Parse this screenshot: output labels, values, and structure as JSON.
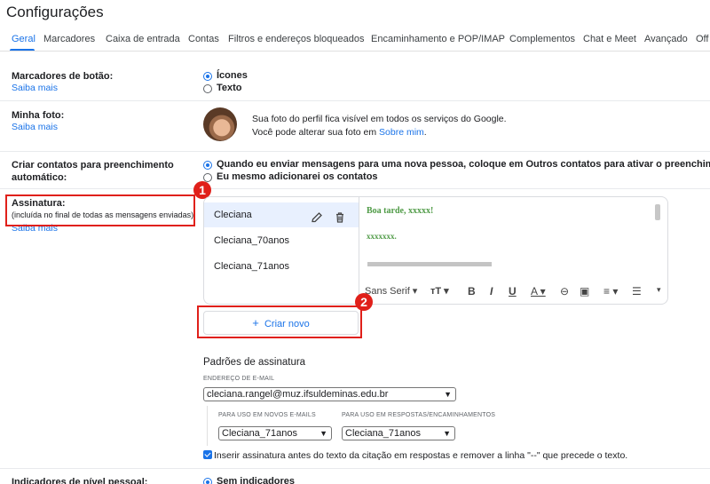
{
  "title": "Configurações",
  "tabs": [
    "Geral",
    "Marcadores",
    "Caixa de entrada",
    "Contas",
    "Filtros e endereços bloqueados",
    "Encaminhamento e POP/IMAP",
    "Complementos",
    "Chat e Meet",
    "Avançado",
    "Off"
  ],
  "active_tab": "Geral",
  "button_labels": {
    "label": "Marcadores de botão:",
    "learn_more": "Saiba mais",
    "options": [
      "Ícones",
      "Texto"
    ],
    "selected": "Ícones"
  },
  "photo": {
    "label": "Minha foto:",
    "learn_more": "Saiba mais",
    "line1": "Sua foto do perfil fica visível em todos os serviços do Google.",
    "line2_prefix": "Você pode alterar sua foto em ",
    "line2_link": "Sobre mim",
    "line2_suffix": "."
  },
  "autocomplete": {
    "label_line1": "Criar contatos para preenchimento",
    "label_line2": "automático:",
    "options": [
      "Quando eu enviar mensagens para uma nova pessoa, coloque em Outros contatos para ativar o preenchimento a",
      "Eu mesmo adicionarei os contatos"
    ],
    "selected_index": 0
  },
  "signature": {
    "label": "Assinatura:",
    "sublabel": "(incluída no final de todas as mensagens enviadas)",
    "learn_more": "Saiba mais",
    "items": [
      "Cleciana",
      "Cleciana_70anos",
      "Cleciana_71anos"
    ],
    "selected": "Cleciana",
    "editor_line1": "Boa tarde, xxxxx!",
    "editor_line2": "xxxxxxx.",
    "font_name": "Sans Serif",
    "create_button": "Criar novo"
  },
  "defaults": {
    "title": "Padrões de assinatura",
    "email_caption": "ENDEREÇO DE E-MAIL",
    "email_value": "cleciana.rangel@muz.ifsuldeminas.edu.br",
    "new_caption": "PARA USO EM NOVOS E-MAILS",
    "new_value": "Cleciana_71anos",
    "reply_caption": "PARA USO EM RESPOSTAS/ENCAMINHAMENTOS",
    "reply_value": "Cleciana_71anos",
    "insert_text": "Inserir assinatura antes do texto da citação em respostas e remover a linha \"--\" que precede o texto.",
    "insert_checked": true
  },
  "personal_indicators": {
    "label": "Indicadores de nível pessoal:",
    "option": "Sem indicadores"
  },
  "annotations": {
    "badge1": "1",
    "badge2": "2",
    "color": "#e0201a"
  },
  "colors": {
    "accent": "#1a73e8",
    "signature_text": "#4e9a45"
  }
}
